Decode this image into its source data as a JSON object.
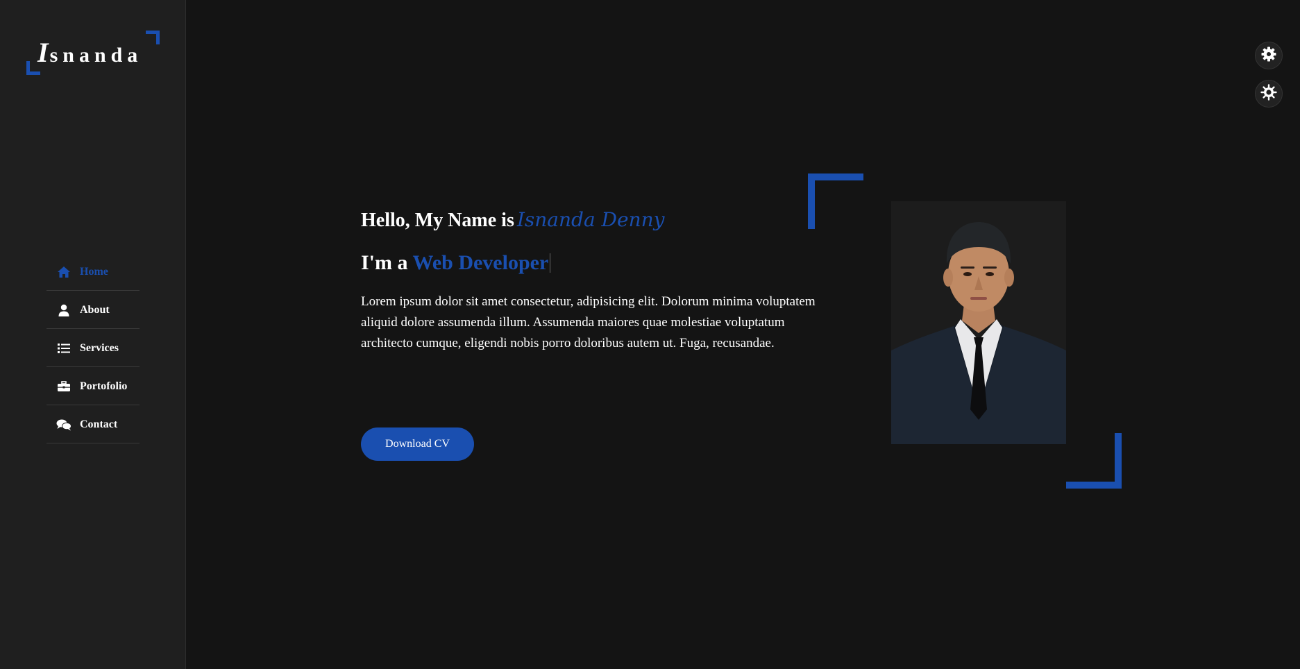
{
  "brand": {
    "logo_initial": "I",
    "logo_rest": "snanda",
    "accent_color": "#1a4fb0"
  },
  "sidebar": {
    "items": [
      {
        "label": "Home",
        "icon": "home-icon",
        "active": true
      },
      {
        "label": "About",
        "icon": "user-icon",
        "active": false
      },
      {
        "label": "Services",
        "icon": "list-icon",
        "active": false
      },
      {
        "label": "Portofolio",
        "icon": "briefcase-icon",
        "active": false
      },
      {
        "label": "Contact",
        "icon": "comments-icon",
        "active": false
      }
    ]
  },
  "settings": {
    "icons": [
      "gear-icon",
      "theme-icon"
    ]
  },
  "hero": {
    "greeting_prefix": "Hello, My Name is",
    "name": "Isnanda Denny",
    "role_prefix": "I'm a",
    "role": "Web Developer",
    "description": "Lorem ipsum dolor sit amet consectetur, adipisicing elit. Dolorum minima voluptatem aliquid dolore assumenda illum. Assumenda maiores quae molestiae voluptatum architecto cumque, eligendi nobis porro doloribus autem ut. Fuga, recusandae.",
    "button_label": "Download CV"
  }
}
